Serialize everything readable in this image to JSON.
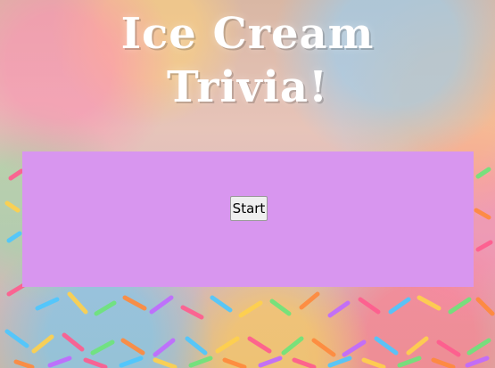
{
  "page": {
    "title_line1": "Ice Cream",
    "title_line2": "Trivia!"
  },
  "panel": {
    "start_label": "Start"
  },
  "colors": {
    "panel_background": "#d896ef",
    "title_text": "#ffffff",
    "button_background": "#efefef"
  }
}
